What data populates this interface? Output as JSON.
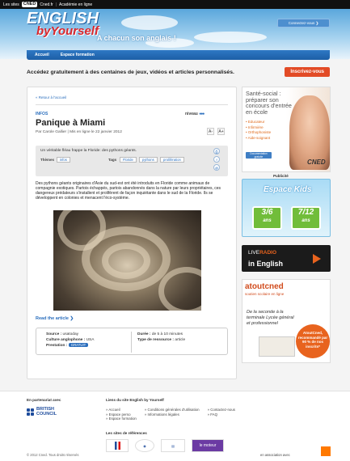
{
  "topbar": {
    "sites_label": "Les sites",
    "logo": "CNED",
    "links": [
      "Cned.fr",
      "Académie en ligne"
    ]
  },
  "header": {
    "brand_line1": "ENGLISH",
    "brand_line2": "byYourself",
    "tagline": "A chacun son anglais !",
    "connect_label": "Connectez-vous ❯"
  },
  "nav": {
    "items": [
      "Accueil",
      "Espace formation"
    ]
  },
  "promo": {
    "text": "Accédez gratuitement à des centaines de jeux, vidéos et articles personnalisés.",
    "button": "Inscrivez-vous"
  },
  "article": {
    "breadcrumb": "« Retour à l'accueil",
    "category": "INFOS",
    "level_label": "niveau",
    "level_value": 3,
    "level_max": 3,
    "title": "Panique à Miami",
    "author": "Par Carole Gallier",
    "date": "Mis en ligne le 22 janvier 2012",
    "font_minus": "A-",
    "font_plus": "A+",
    "summary": "Un véritable fléau frappe la Floride: des pythons géants.",
    "themes_label": "Thèmes",
    "themes": [
      "infos"
    ],
    "tags_label": "Tags",
    "tags": [
      "Floride",
      "pythons",
      "prolifération"
    ],
    "paragraph": "Des pythons géants originaires d'Asie du sud-est ont été introduits en Floride comme animaux de compagnie exotiques. Partois échappés, partois abandonnés dans la nature par leurs propriétaires, ces dangereux prédateurs s'installent et prolifèrent de façon inquiétante dans le sud de la Floride. Ils se développent en colonies et menacent l'éco-système.",
    "read_more": "Read the article ❯",
    "meta": {
      "source_label": "Source :",
      "source": "usatoday",
      "culture_label": "Culture anglophone :",
      "culture": "USA",
      "prestation_label": "Prestation :",
      "prestation": "GRATUIT",
      "duree_label": "Durée :",
      "duree": "de 5 à 10 minutes",
      "type_label": "Type de ressource :",
      "type": "article"
    }
  },
  "ads": {
    "sante_title": "Santé-social : préparer son concours d'entrée en école",
    "sante_items": [
      "• Educateur",
      "• Infirmière",
      "• Orthophoniste",
      "• Aide-soignant"
    ],
    "sante_doc": "Documentation gratuite",
    "sante_brand": "CNED",
    "pub_label": "Publicité",
    "kids_title": "Espace Kids",
    "kids_age1": "3/6",
    "kids_age2": "7/12",
    "kids_unit": "ans",
    "radio_l1a": "LIVE",
    "radio_l1b": "RADIO",
    "radio_l2": "in English",
    "atout_title": "atoutcned",
    "atout_sub": "soutien scolaire en ligne",
    "atout_text": "De la seconde à la terminale Lycée général et professionnel",
    "atout_badge": "AtoutCned, recommandé par 90 % de nos inscrits*"
  },
  "footer": {
    "partner_title": "En partenariat avec",
    "partner_name_1": "BRITISH",
    "partner_name_2": "COUNCIL",
    "links_title": "Liens du site English by Yourself",
    "links_col1": [
      "» Accueil",
      "» Espace perso",
      "» Espace formation"
    ],
    "links_col2": [
      "» Conditions générales d'utilisation",
      "» Informations légales"
    ],
    "links_col3": [
      "» Contactez-nous",
      "» FAQ"
    ],
    "refs_title": "Les sites de références",
    "ref_moteur": "le moteur",
    "copyright": "© 2012 Cned. Tous droits réservés",
    "assoc": "en association avec"
  },
  "colors": {
    "accent": "#2a6ebd",
    "promo_button": "#e24b26",
    "nav": "#1d5fa6",
    "orange": "#ff7900"
  }
}
